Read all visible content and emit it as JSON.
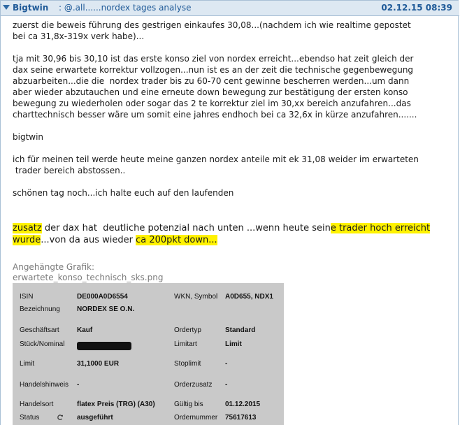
{
  "header": {
    "author": "Bigtwin",
    "subject": ": @.all......nordex tages analyse",
    "date": "02.12.15 08:39"
  },
  "body": {
    "p1": "zuerst die beweis führung des gestrigen einkaufes 30,08...(nachdem ich wie realtime gepostet\nbei ca 31,8x-319x verk habe)...",
    "p2": "tja mit 30,96 bis 30,10 ist das erste konso ziel von nordex erreicht...ebendso hat zeit gleich der\ndax seine erwartete korrektur vollzogen...nun ist es an der zeit die technische gegenbewegung\nabzuarbeiten...die die  nordex trader bis zu 60-70 cent gewinne bescherren werden...um dann\naber wieder abzutauchen und eine erneute down bewegung zur bestätigung der ersten konso\nbewegung zu wiederholen oder sogar das 2 te korrektur ziel im 30,xx bereich anzufahren...das\ncharttechnisch besser wäre um somit eine jahres endhoch bei ca 32,6x in kürze anzufahren.......",
    "sig": "bigtwin",
    "p3": "ich für meinen teil werde heute meine ganzen nordex anteile mit ek 31,08 weider im erwarteten\n trader bereich abstossen..",
    "p4": "schönen tag noch...ich halte euch auf den laufenden",
    "p5": {
      "a": "zusatz",
      "b": " der dax hat  deutliche potenzial nach unten ...wenn heute sein",
      "c": "e trader hoch erreicht",
      "d": "wurde",
      "e": "...von da aus wieder ",
      "f": "ca 200pkt down..."
    },
    "attach_title": "Angehängte Grafik:",
    "attach_file": "erwartete_konso_technisch_sks.png"
  },
  "order": {
    "isin_label": "ISIN",
    "isin": "DE000A0D6554",
    "wkn_label": "WKN, Symbol",
    "wkn": "A0D655, NDX1",
    "bez_label": "Bezeichnung",
    "bez": "NORDEX SE O.N.",
    "art_label": "Geschäftsart",
    "art": "Kauf",
    "ordertyp_label": "Ordertyp",
    "ordertyp": "Standard",
    "stueck_label": "Stück/Nominal",
    "limitart_label": "Limitart",
    "limitart": "Limit",
    "limit_label": "Limit",
    "limit": "31,1000 EUR",
    "stoplimit_label": "Stoplimit",
    "stoplimit": "-",
    "hinweis_label": "Handelshinweis",
    "hinweis": "-",
    "zusatz_label": "Orderzusatz",
    "zusatz": "-",
    "ort_label": "Handelsort",
    "ort": "flatex Preis (TRG) (A30)",
    "gueltig_label": "Gültig bis",
    "gueltig": "01.12.2015",
    "status_label": "Status",
    "status": "ausgeführt",
    "nr_label": "Ordernummer",
    "nr": "75617613"
  }
}
